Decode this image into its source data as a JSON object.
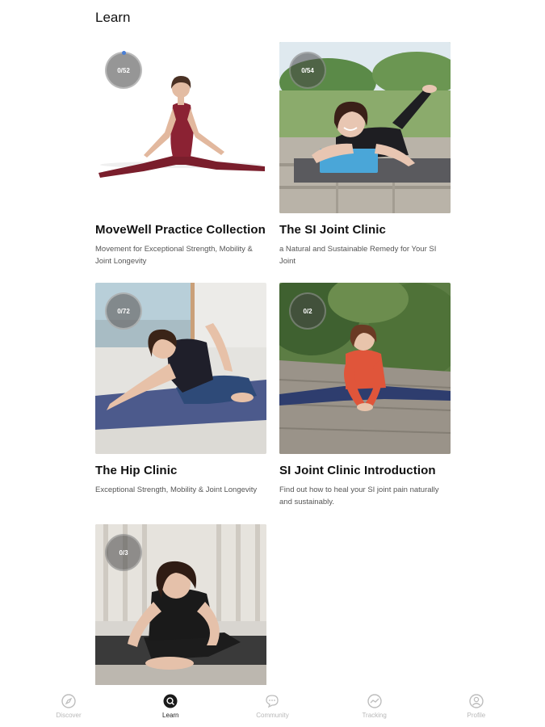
{
  "header": {
    "title": "Learn"
  },
  "cards": [
    {
      "title": "MoveWell Practice Collection",
      "description": "Movement for Exceptional Strength, Mobility & Joint Longevity",
      "progress": "0/52"
    },
    {
      "title": "The SI Joint Clinic",
      "description": "a Natural and Sustainable Remedy for Your SI Joint",
      "progress": "0/54"
    },
    {
      "title": "The Hip Clinic",
      "description": "Exceptional Strength, Mobility & Joint Longevity",
      "progress": "0/72"
    },
    {
      "title": "SI Joint Clinic Introduction",
      "description": "Find out how to heal your SI joint pain naturally and sustainably.",
      "progress": "0/2"
    },
    {
      "title": "",
      "description": "",
      "progress": "0/3"
    }
  ],
  "nav": {
    "items": [
      {
        "label": "Discover",
        "icon": "compass-icon",
        "active": false
      },
      {
        "label": "Learn",
        "icon": "learn-icon",
        "active": true
      },
      {
        "label": "Community",
        "icon": "chat-icon",
        "active": false
      },
      {
        "label": "Tracking",
        "icon": "tracking-icon",
        "active": false
      },
      {
        "label": "Profile",
        "icon": "profile-icon",
        "active": false
      }
    ]
  },
  "colors": {
    "accent": "#4a7fd6",
    "active_nav": "#222222",
    "inactive_nav": "#b8b8b8"
  }
}
